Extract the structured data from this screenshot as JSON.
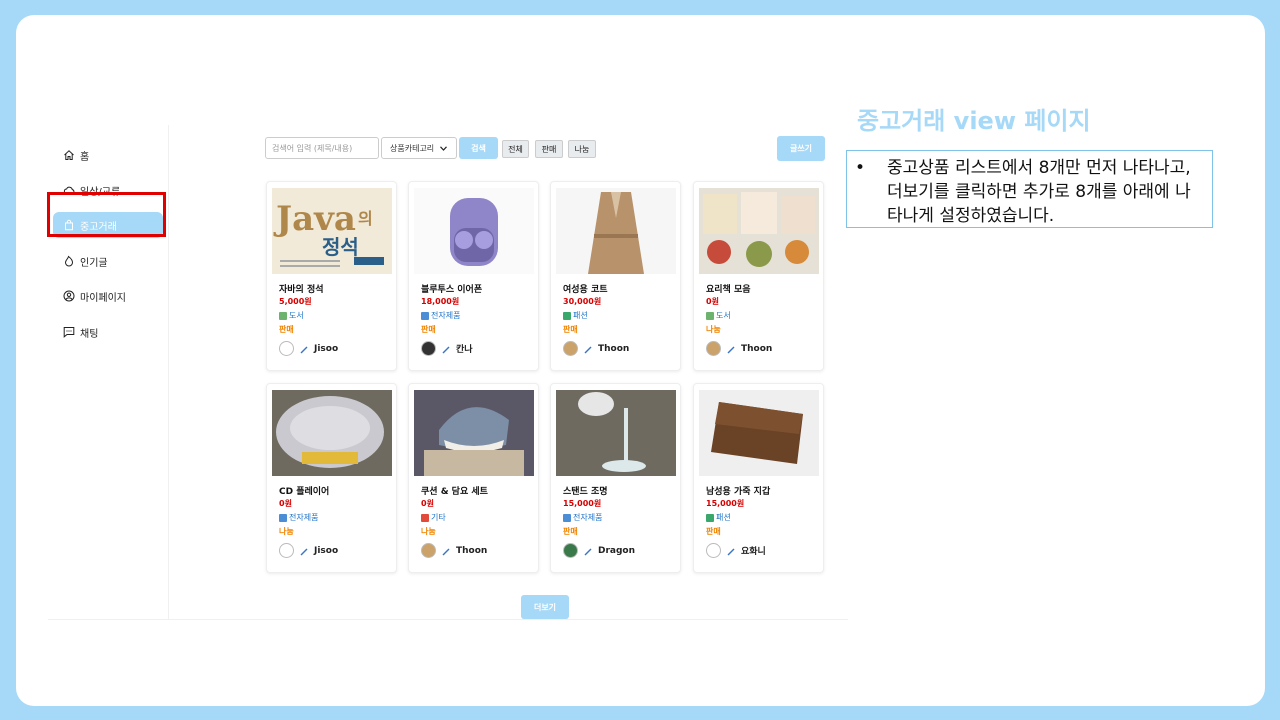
{
  "sidebar": {
    "items": [
      {
        "label": "홈",
        "icon": "home-icon"
      },
      {
        "label": "일상/교류",
        "icon": "cloud-icon"
      },
      {
        "label": "중고거래",
        "icon": "shopping-bag-icon",
        "active": true
      },
      {
        "label": "인기글",
        "icon": "fire-icon"
      },
      {
        "label": "마이페이지",
        "icon": "user-circle-icon"
      },
      {
        "label": "채팅",
        "icon": "chat-icon"
      }
    ]
  },
  "toolbar": {
    "search_placeholder": "검색어 입력 (제목/내용)",
    "category_select": "상품카테고리",
    "search_button": "검색",
    "filter_all": "전체",
    "filter_sell": "판매",
    "filter_share": "나눔",
    "write_button": "글쓰기"
  },
  "products": [
    {
      "title": "자바의 정석",
      "price": "5,000원",
      "category": "도서",
      "type": "판매",
      "author": "Jisoo",
      "image": "book-java-image",
      "image_text": "Java의 정석"
    },
    {
      "title": "블루투스 이어폰",
      "price": "18,000원",
      "category": "전자제품",
      "type": "판매",
      "author": "칸나",
      "image": "earbuds-image"
    },
    {
      "title": "여성용 코트",
      "price": "30,000원",
      "category": "패션",
      "type": "판매",
      "author": "Thoon",
      "image": "coat-image"
    },
    {
      "title": "요리책 모음",
      "price": "0원",
      "category": "도서",
      "type": "나눔",
      "author": "Thoon",
      "image": "cookbooks-image"
    },
    {
      "title": "CD 플레이어",
      "price": "0원",
      "category": "전자제품",
      "type": "나눔",
      "author": "Jisoo",
      "image": "cd-player-image"
    },
    {
      "title": "쿠션 & 담요 세트",
      "price": "0원",
      "category": "기타",
      "type": "나눔",
      "author": "Thoon",
      "image": "shark-cushion-image"
    },
    {
      "title": "스탠드 조명",
      "price": "15,000원",
      "category": "전자제품",
      "type": "판매",
      "author": "Dragon",
      "image": "desk-lamp-image"
    },
    {
      "title": "남성용 가죽 지갑",
      "price": "15,000원",
      "category": "패션",
      "type": "판매",
      "author": "요화니",
      "image": "leather-wallet-image"
    }
  ],
  "more_button": "더보기",
  "annotation": {
    "heading": "중고거래 view 페이지",
    "bullet": "•",
    "description": "중고상품 리스트에서 8개만 먼저 나타나고, 더보기를 클릭하면 추가로 8개를 아래에 나타나게 설정하였습니다."
  },
  "colors": {
    "accent": "#a6d8f7",
    "price": "#d60000",
    "type": "#f08400",
    "category": "#1e74c8",
    "highlight": "#e00000"
  }
}
